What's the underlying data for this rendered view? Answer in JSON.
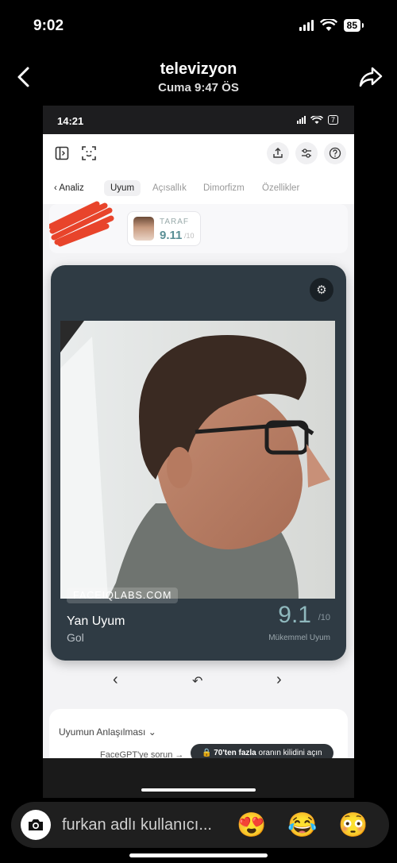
{
  "status": {
    "time": "9:02",
    "battery": "85"
  },
  "story": {
    "title": "televizyon",
    "subtitle": "Cuma 9:47 ÖS"
  },
  "app": {
    "status_time": "14:21",
    "battery": "7",
    "tabs": [
      {
        "label": "Analiz"
      },
      {
        "label": "Uyum"
      },
      {
        "label": "Açısallık"
      },
      {
        "label": "Dimorfizm"
      },
      {
        "label": "Özellikler"
      }
    ],
    "chip": {
      "label": "TARAF",
      "score": "9.11",
      "unit": "/10"
    },
    "card": {
      "brand": "FACEIQLABS.COM",
      "title": "Yan Uyum",
      "subtitle": "Gol",
      "score": "9.1",
      "unit": "/10",
      "rating": "Mükemmel Uyum"
    },
    "panel": {
      "understanding": "Uyumun Anlaşılması",
      "facegpt": "FaceGPT'ye sorun →",
      "unlock_bold": "70'ten fazla",
      "unlock_rest": " oranın kilidini açın"
    }
  },
  "reply": {
    "placeholder": "furkan adlı kullanıcı...",
    "emojis": [
      "😍",
      "😂",
      "😳"
    ]
  }
}
